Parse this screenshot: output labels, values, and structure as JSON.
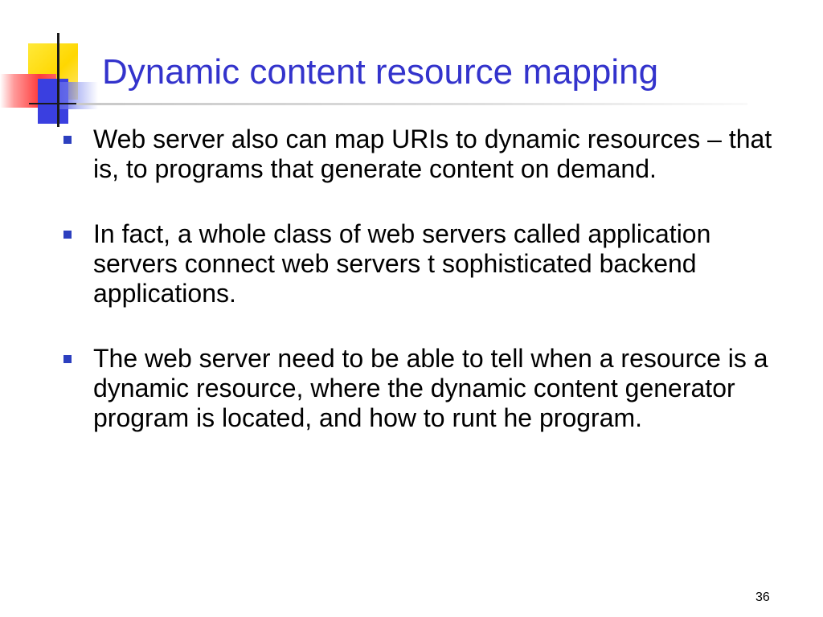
{
  "slide": {
    "title": "Dynamic content resource mapping",
    "bullets": [
      "Web server also can map URIs to dynamic resources – that is, to programs that generate content on demand.",
      "In fact, a whole class of web servers called application servers connect web servers t sophisticated backend applications.",
      "The web server need to be able to tell when a resource is a dynamic resource, where the dynamic content generator program is located, and how to runt he program."
    ],
    "page_number": "36"
  },
  "colors": {
    "title": "#3333cc",
    "bullet_marker": "#2c3fbf",
    "ornament_yellow": "#ffd700",
    "ornament_red": "#ff3b3b",
    "ornament_blue": "#3a3fe0"
  },
  "icons": {
    "bullet": "square-bullet-icon"
  }
}
